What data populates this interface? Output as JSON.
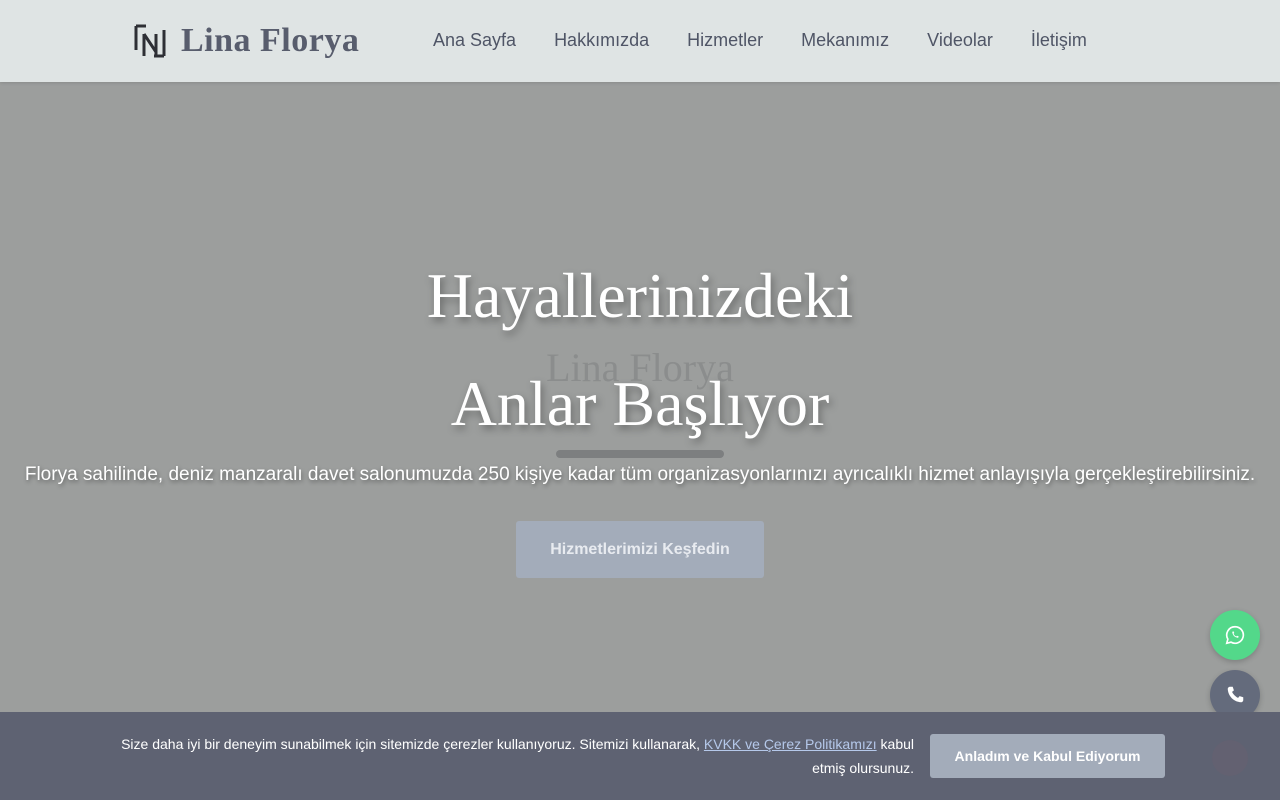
{
  "header": {
    "logo_text": "Lina Florya",
    "nav": [
      {
        "label": "Ana Sayfa"
      },
      {
        "label": "Hakkımızda"
      },
      {
        "label": "Hizmetler"
      },
      {
        "label": "Mekanımız"
      },
      {
        "label": "Videolar"
      },
      {
        "label": "İletişim"
      }
    ]
  },
  "hero": {
    "ghost_text": "Lina Florya",
    "title_line1": "Hayallerinizdeki",
    "title_line2": "Anlar Başlıyor",
    "subtitle": "Florya sahilinde, deniz manzaralı davet salonumuzda 250 kişiye kadar tüm organizasyonlarınızı ayrıcalıklı hizmet anlayışıyla gerçekleştirebilirsiniz.",
    "cta_label": "Hizmetlerimizi Keşfedin"
  },
  "floating": {
    "whatsapp_icon": "whatsapp-icon",
    "phone_icon": "phone-icon"
  },
  "cookie": {
    "text_before": "Size daha iyi bir deneyim sunabilmek için sitemizde çerezler kullanıyoruz. Sitemizi kullanarak, ",
    "link_label": "KVKK ve Çerez Politikamızı",
    "text_after": " kabul etmiş olursunuz.",
    "accept_label": "Anladım ve Kabul Ediyorum"
  },
  "colors": {
    "header_bg": "#dfe4e4",
    "hero_overlay": "#9c9e9d",
    "cta_bg": "#a3acba",
    "cookie_bg": "#5e6272",
    "whatsapp_green": "#53d88a",
    "phone_gray": "#646b7c"
  }
}
